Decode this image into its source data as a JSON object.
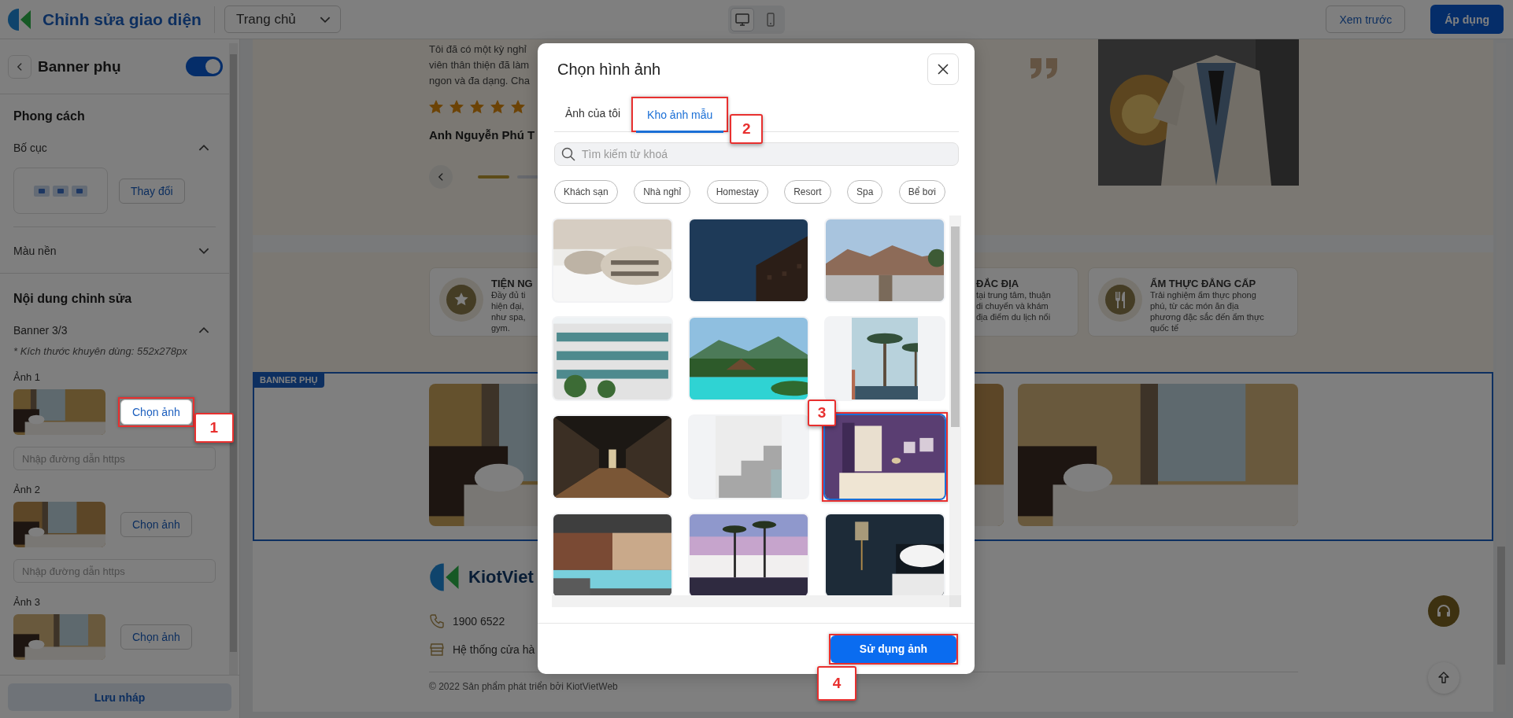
{
  "topbar": {
    "title": "Chỉnh sửa giao diện",
    "page_select": "Trang chủ",
    "devices": [
      {
        "kind": "desktop",
        "selected": true
      },
      {
        "kind": "mobile",
        "selected": false
      }
    ],
    "preview_button": "Xem trước",
    "apply_button": "Áp dụng"
  },
  "sidebar": {
    "title": "Banner phụ",
    "enabled": true,
    "style_heading": "Phong cách",
    "layout_label": "Bố cục",
    "layout_expanded": true,
    "change_button": "Thay đổi",
    "background_label": "Màu nền",
    "background_expanded": false,
    "content_heading": "Nội dung chỉnh sửa",
    "banner_label": "Banner 3/3",
    "banner_expanded": true,
    "size_hint": "* Kích thước khuyên dùng: 552x278px",
    "images": [
      {
        "label": "Ảnh 1",
        "button": "Chọn ảnh",
        "placeholder": "Nhập đường dẫn https",
        "callout": "1"
      },
      {
        "label": "Ảnh 2",
        "button": "Chọn ảnh",
        "placeholder": "Nhập đường dẫn https"
      },
      {
        "label": "Ảnh 3",
        "button": "Chọn ảnh"
      }
    ],
    "save_button": "Lưu nháp"
  },
  "preview": {
    "testimonial": {
      "lines": [
        "Tôi đã có một kỳ nghỉ",
        "viên thân thiện đã làm",
        "ngon và đa dạng. Cha"
      ],
      "stars": 5,
      "author": "Anh Nguyễn Phú T",
      "slides": [
        {
          "selected": true
        },
        {
          "selected": false
        }
      ]
    },
    "features": [
      {
        "title": "TIỆN NG",
        "lines": [
          "Đầy đủ ti",
          "hiện đại,",
          "như spa,",
          "gym."
        ]
      },
      {
        "title": "ĐẮC ĐỊA",
        "lines": [
          "tại trung tâm, thuận",
          "di chuyển và khám",
          "địa điểm du lịch nổi"
        ]
      },
      {
        "title": "ẨM THỰC ĐẲNG CẤP",
        "lines": [
          "Trải nghiệm ẩm thực phong",
          "phú, từ các món ăn địa",
          "phương đặc sắc đến ẩm thực",
          "quốc tế"
        ]
      }
    ],
    "banner": {
      "label": "BANNER PHỤ",
      "images": [
        {
          "kind": "picture"
        },
        {
          "kind": "picture"
        },
        {
          "kind": "picture"
        }
      ]
    },
    "footer": {
      "brand": "KiotViet",
      "phone": "1900 6522",
      "stores": "Hệ thống cửa hà",
      "copyright": "© 2022 Sản phẩm phát triển bởi KiotVietWeb"
    }
  },
  "dialog": {
    "title": "Chọn hình ảnh",
    "tabs": [
      {
        "label": "Ảnh của tôi",
        "selected": false
      },
      {
        "label": "Kho ảnh mẫu",
        "selected": true,
        "callout": "2"
      }
    ],
    "search": {
      "placeholder": "Tìm kiếm từ khoá"
    },
    "filters": [
      "Khách sạn",
      "Nhà nghỉ",
      "Homestay",
      "Resort",
      "Spa",
      "Bể bơi"
    ],
    "images": [
      {
        "kind": "picture",
        "selected": false
      },
      {
        "kind": "picture",
        "selected": false
      },
      {
        "kind": "picture",
        "selected": false
      },
      {
        "kind": "picture",
        "selected": false
      },
      {
        "kind": "picture",
        "selected": false
      },
      {
        "kind": "picture",
        "selected": false
      },
      {
        "kind": "picture",
        "selected": false
      },
      {
        "kind": "picture",
        "selected": false
      },
      {
        "kind": "picture",
        "selected": true,
        "callout": "3"
      },
      {
        "kind": "picture",
        "selected": false
      },
      {
        "kind": "picture",
        "selected": false
      },
      {
        "kind": "picture",
        "selected": false
      }
    ],
    "confirm_button": {
      "label": "Sử dụng ảnh",
      "callout": "4"
    }
  }
}
